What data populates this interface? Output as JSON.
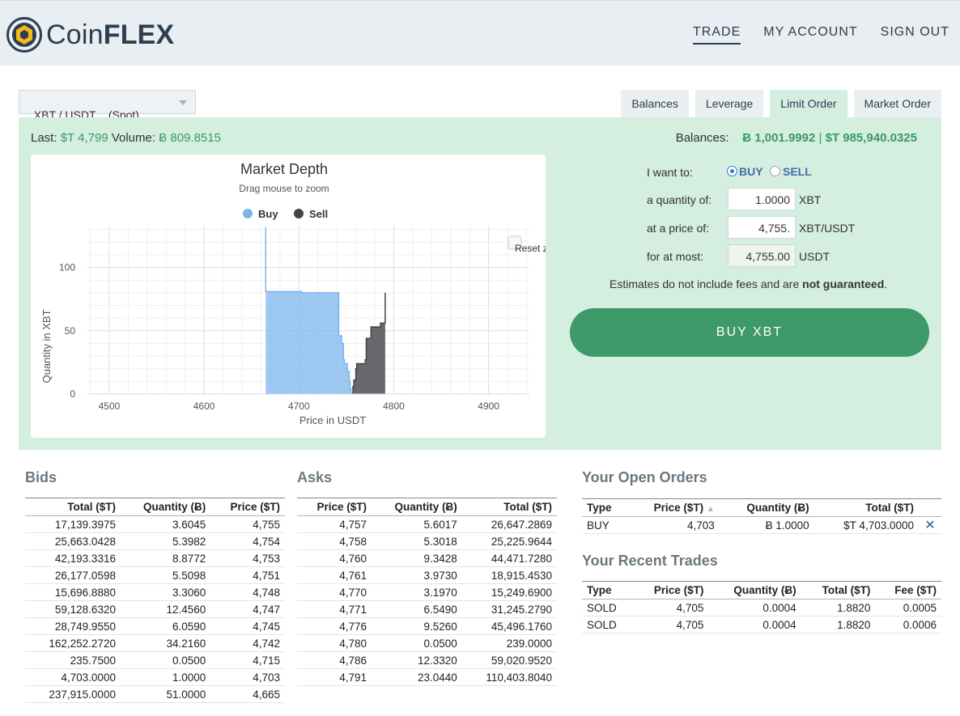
{
  "header": {
    "logo_coin": "Coin",
    "logo_flex": "FLEX",
    "nav": [
      {
        "label": "TRADE",
        "active": true
      },
      {
        "label": "MY ACCOUNT",
        "active": false
      },
      {
        "label": "SIGN OUT",
        "active": false
      }
    ]
  },
  "pair_select": {
    "value": "XBT / USDT    (Spot)"
  },
  "tabs": [
    {
      "label": "Balances",
      "active": false
    },
    {
      "label": "Leverage",
      "active": false
    },
    {
      "label": "Limit Order",
      "active": true
    },
    {
      "label": "Market Order",
      "active": false
    }
  ],
  "stats": {
    "last_label": "Last:",
    "last_value": "$T 4,799",
    "volume_label": "Volume:",
    "volume_value": "Ƀ 809.8515"
  },
  "balances": {
    "label": "Balances:",
    "xbt": "Ƀ 1,001.9992",
    "sep": "|",
    "usdt": "$T 985,940.0325"
  },
  "chart": {
    "title": "Market Depth",
    "subtitle": "Drag mouse to zoom",
    "reset_label": "Reset z",
    "legend": [
      {
        "name": "Buy",
        "color": "#7cb5ec"
      },
      {
        "name": "Sell",
        "color": "#434348"
      }
    ]
  },
  "chart_data": {
    "type": "area",
    "title": "Market Depth",
    "subtitle": "Drag mouse to zoom",
    "xlabel": "Price in USDT",
    "ylabel": "Quantity in XBT",
    "xlim": [
      4477,
      4943
    ],
    "ylim": [
      0,
      133
    ],
    "x_ticks": [
      4500,
      4600,
      4700,
      4800,
      4900
    ],
    "y_ticks": [
      0,
      50,
      100
    ],
    "grid": true,
    "legend_position": "top",
    "series": [
      {
        "name": "Buy",
        "color": "#7cb5ec",
        "points": [
          [
            4665,
            132
          ],
          [
            4665,
            81
          ],
          [
            4703,
            81
          ],
          [
            4703,
            80
          ],
          [
            4742,
            80
          ],
          [
            4742,
            46
          ],
          [
            4745,
            46
          ],
          [
            4745,
            40
          ],
          [
            4747,
            40
          ],
          [
            4747,
            27
          ],
          [
            4748,
            27
          ],
          [
            4748,
            24
          ],
          [
            4751,
            24
          ],
          [
            4751,
            18
          ],
          [
            4753,
            18
          ],
          [
            4753,
            10
          ],
          [
            4754,
            10
          ],
          [
            4754,
            4
          ],
          [
            4755,
            4
          ],
          [
            4755,
            0
          ]
        ]
      },
      {
        "name": "Sell",
        "color": "#434348",
        "points": [
          [
            4757,
            0
          ],
          [
            4757,
            6
          ],
          [
            4758,
            6
          ],
          [
            4758,
            11
          ],
          [
            4760,
            11
          ],
          [
            4760,
            20
          ],
          [
            4761,
            20
          ],
          [
            4761,
            24
          ],
          [
            4770,
            24
          ],
          [
            4770,
            27
          ],
          [
            4771,
            27
          ],
          [
            4771,
            44
          ],
          [
            4776,
            44
          ],
          [
            4776,
            53
          ],
          [
            4780,
            53
          ],
          [
            4780,
            53
          ],
          [
            4786,
            53
          ],
          [
            4786,
            56
          ],
          [
            4791,
            56
          ],
          [
            4791,
            80
          ]
        ]
      }
    ]
  },
  "order_form": {
    "want_label": "I want to:",
    "buy_label": "BUY",
    "sell_label": "SELL",
    "quantity_label": "a quantity of:",
    "quantity_value": "1.0000",
    "quantity_unit": "XBT",
    "price_label": "at a price of:",
    "price_value": "4,755.",
    "price_unit": "XBT/USDT",
    "most_label": "for at most:",
    "most_value": "4,755.00",
    "most_unit": "USDT",
    "note_prefix": "Estimates do not include fees and are ",
    "note_bold": "not guaranteed",
    "note_suffix": ".",
    "submit_label": "BUY XBT"
  },
  "bids": {
    "title": "Bids",
    "columns": [
      "Total ($T)",
      "Quantity (Ƀ)",
      "Price ($T)"
    ],
    "rows": [
      [
        "17,139.3975",
        "3.6045",
        "4,755"
      ],
      [
        "25,663.0428",
        "5.3982",
        "4,754"
      ],
      [
        "42,193.3316",
        "8.8772",
        "4,753"
      ],
      [
        "26,177.0598",
        "5.5098",
        "4,751"
      ],
      [
        "15,696.8880",
        "3.3060",
        "4,748"
      ],
      [
        "59,128.6320",
        "12.4560",
        "4,747"
      ],
      [
        "28,749.9550",
        "6.0590",
        "4,745"
      ],
      [
        "162,252.2720",
        "34.2160",
        "4,742"
      ],
      [
        "235.7500",
        "0.0500",
        "4,715"
      ],
      [
        "4,703.0000",
        "1.0000",
        "4,703"
      ],
      [
        "237,915.0000",
        "51.0000",
        "4,665"
      ]
    ]
  },
  "asks": {
    "title": "Asks",
    "columns": [
      "Price ($T)",
      "Quantity (Ƀ)",
      "Total ($T)"
    ],
    "rows": [
      [
        "4,757",
        "5.6017",
        "26,647.2869"
      ],
      [
        "4,758",
        "5.3018",
        "25,225.9644"
      ],
      [
        "4,760",
        "9.3428",
        "44,471.7280"
      ],
      [
        "4,761",
        "3.9730",
        "18,915.4530"
      ],
      [
        "4,770",
        "3.1970",
        "15,249.6900"
      ],
      [
        "4,771",
        "6.5490",
        "31,245.2790"
      ],
      [
        "4,776",
        "9.5260",
        "45,496.1760"
      ],
      [
        "4,780",
        "0.0500",
        "239.0000"
      ],
      [
        "4,786",
        "12.3320",
        "59,020.9520"
      ],
      [
        "4,791",
        "23.0440",
        "110,403.8040"
      ]
    ]
  },
  "open_orders": {
    "title": "Your Open Orders",
    "columns": [
      "Type",
      "Price ($T)",
      "Quantity (Ƀ)",
      "Total ($T)"
    ],
    "sort_indicator": "▲",
    "rows": [
      {
        "type": "BUY",
        "price": "4,703",
        "quantity": "Ƀ 1.0000",
        "total": "$T 4,703.0000",
        "cancel": "✕"
      }
    ]
  },
  "recent_trades": {
    "title": "Your Recent Trades",
    "columns": [
      "Type",
      "Price ($T)",
      "Quantity (Ƀ)",
      "Total ($T)",
      "Fee ($T)"
    ],
    "rows": [
      [
        "SOLD",
        "4,705",
        "0.0004",
        "1.8820",
        "0.0005"
      ],
      [
        "SOLD",
        "4,705",
        "0.0004",
        "1.8820",
        "0.0006"
      ]
    ]
  }
}
